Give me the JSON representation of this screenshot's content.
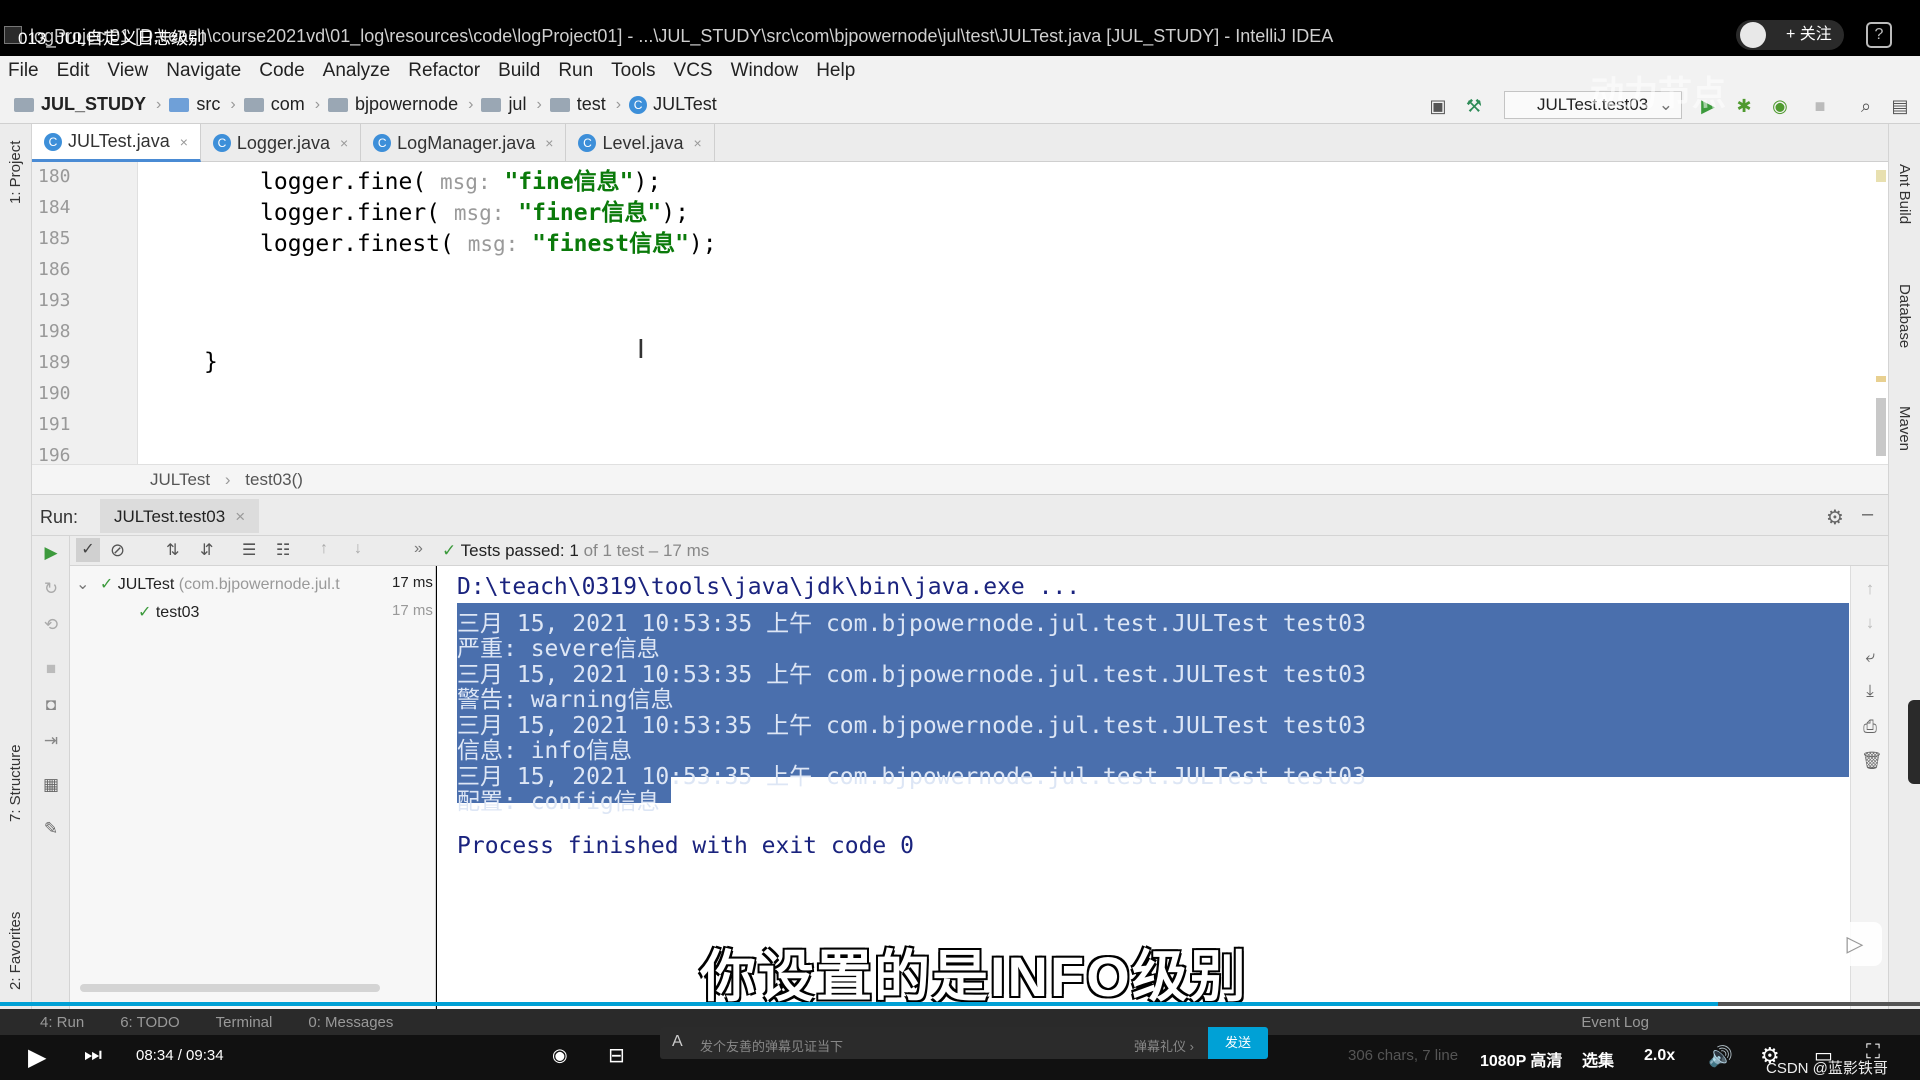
{
  "video": {
    "title": "013_JUL自定义日志级别"
  },
  "window": {
    "title": "logProject01 [D:\\teach\\course2021vd\\01_log\\resources\\code\\logProject01] - ...\\JUL_STUDY\\src\\com\\bjpowernode\\jul\\test\\JULTest.java [JUL_STUDY] - IntelliJ IDEA"
  },
  "header_right": {
    "follow_label": "+ 关注",
    "watermark": "动力节点"
  },
  "menu": [
    "File",
    "Edit",
    "View",
    "Navigate",
    "Code",
    "Analyze",
    "Refactor",
    "Build",
    "Run",
    "Tools",
    "VCS",
    "Window",
    "Help"
  ],
  "breadcrumb": {
    "project": "JUL_STUDY",
    "items": [
      "src",
      "com",
      "bjpowernode",
      "jul",
      "test"
    ],
    "class": "JULTest"
  },
  "run_config": {
    "label": "JULTest.test03"
  },
  "tabs": [
    {
      "label": "JULTest.java",
      "active": true
    },
    {
      "label": "Logger.java",
      "active": false
    },
    {
      "label": "LogManager.java",
      "active": false
    },
    {
      "label": "Level.java",
      "active": false
    }
  ],
  "left_strip": {
    "project": "1: Project",
    "structure": "7: Structure",
    "favorites": "2: Favorites"
  },
  "right_strip": {
    "ant": "Ant Build",
    "database": "Database",
    "maven": "Maven"
  },
  "editor": {
    "line_numbers": [
      "180",
      "184",
      "185",
      "186",
      "193",
      "198",
      "189",
      "190",
      "191",
      "196"
    ],
    "lines": [
      {
        "prefix": "logger.fine( ",
        "hint": "msg:",
        "str": " \"fine信息\"",
        "suffix": ");"
      },
      {
        "prefix": "logger.finer( ",
        "hint": "msg:",
        "str": " \"finer信息\"",
        "suffix": ");"
      },
      {
        "prefix": "logger.finest( ",
        "hint": "msg:",
        "str": " \"finest信息\"",
        "suffix": ");"
      }
    ],
    "closing_brace": "}",
    "breadcrumb_class": "JULTest",
    "breadcrumb_method": "test03()"
  },
  "run": {
    "label": "Run:",
    "tab": "JULTest.test03",
    "status_prefix": "Tests passed:",
    "status_count": "1",
    "status_suffix": "of 1 test – 17 ms",
    "tree": {
      "root": "JULTest",
      "root_pkg": "(com.bjpowernode.jul.t",
      "root_time": "17 ms",
      "child": "test03",
      "child_time": "17 ms"
    },
    "console": [
      {
        "text": "D:\\teach\\0319\\tools\\java\\jdk\\bin\\java.exe ...",
        "selected": false,
        "color": "#1a237e"
      },
      {
        "text": "三月 15, 2021 10:53:35 上午 com.bjpowernode.jul.test.JULTest test03",
        "selected": true
      },
      {
        "text": "严重: severe信息",
        "selected": true
      },
      {
        "text": "三月 15, 2021 10:53:35 上午 com.bjpowernode.jul.test.JULTest test03",
        "selected": true
      },
      {
        "text": "警告: warning信息",
        "selected": true
      },
      {
        "text": "三月 15, 2021 10:53:35 上午 com.bjpowernode.jul.test.JULTest test03",
        "selected": true
      },
      {
        "text": "信息: info信息",
        "selected": true
      },
      {
        "text": "三月 15, 2021 10:53:35 上午 com.bjpowernode.jul.test.JULTest test03",
        "selected": true
      },
      {
        "text": "配置: config信息",
        "selected": true
      },
      {
        "text": "",
        "selected": false
      },
      {
        "text": "Process finished with exit code 0",
        "selected": false,
        "color": "#1a237e"
      }
    ]
  },
  "bottom_tabs": [
    "4: Run",
    "6: TODO",
    "Terminal",
    "0: Messages",
    "Event Log"
  ],
  "subtitle": "你设置的是INFO级别",
  "player": {
    "time": "08:34 / 09:34",
    "progress": 0.895,
    "danmaku_placeholder": "发个友善的弹幕见证当下",
    "danmaku_etiquette": "弹幕礼仪 ›",
    "send": "发送",
    "quality": "1080P 高清",
    "episodes": "选集",
    "speed": "2.0x",
    "status_chars": "306 chars, 7 line",
    "csdn": "CSDN @蓝影铁哥"
  }
}
